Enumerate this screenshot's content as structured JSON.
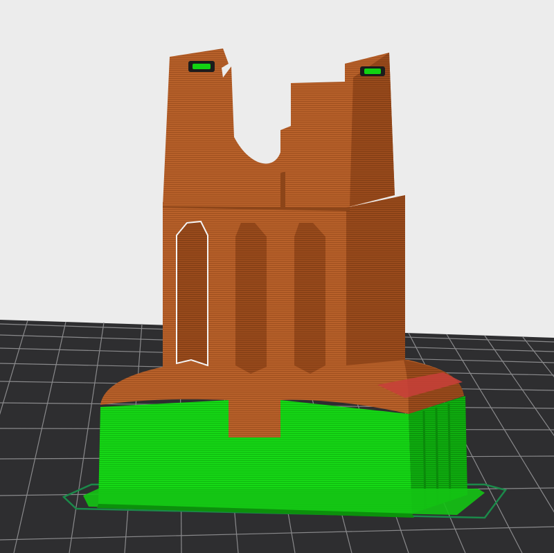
{
  "viewer": {
    "background_color": "#ececec",
    "bed_color": "#2e2e30",
    "bed_grid_color": "#8a8a8c"
  },
  "preview": {
    "perimeter_color": "#b8612a",
    "perimeter_shadow_color": "#8c4519",
    "support_color": "#12d312",
    "support_shadow_color": "#0b9a0b",
    "skirt_color": "#1b8a4a",
    "overhang_color": "#c8403a"
  }
}
